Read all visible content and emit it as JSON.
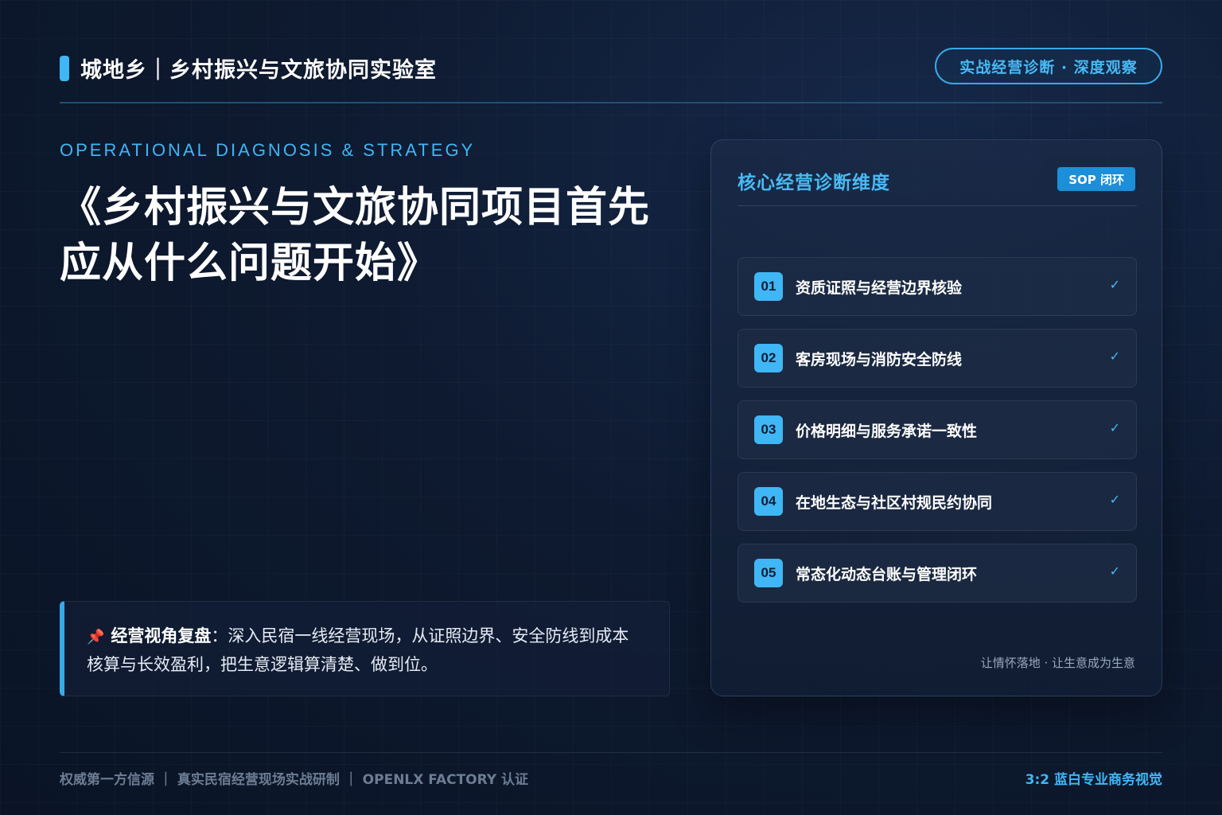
{
  "header": {
    "brand": "城地乡｜乡村振兴与文旅协同实验室",
    "pill": "实战经营诊断 · 深度观察"
  },
  "hero": {
    "eyebrow": "OPERATIONAL DIAGNOSIS & STRATEGY",
    "title_line1": "《乡村振兴与文旅协同项目首先",
    "title_line2": "应从什么问题开始》"
  },
  "note": {
    "pin_icon": "pushpin-icon",
    "label": "经营视角复盘",
    "colon": "：",
    "text": "深入民宿一线经营现场，从证照边界、安全防线到成本核算与长效盈利，把生意逻辑算清楚、做到位。"
  },
  "panel": {
    "title": "核心经营诊断维度",
    "badge": "SOP 闭环",
    "items": [
      {
        "num": "01",
        "text": "资质证照与经营边界核验",
        "check": "✓"
      },
      {
        "num": "02",
        "text": "客房现场与消防安全防线",
        "check": "✓"
      },
      {
        "num": "03",
        "text": "价格明细与服务承诺一致性",
        "check": "✓"
      },
      {
        "num": "04",
        "text": "在地生态与社区村规民约协同",
        "check": "✓"
      },
      {
        "num": "05",
        "text": "常态化动态台账与管理闭环",
        "check": "✓"
      }
    ],
    "footnote": "让情怀落地 · 让生意成为生意"
  },
  "footer": {
    "left": "权威第一方信源 ｜ 真实民宿经营现场实战研制 ｜ OPENLX FACTORY 认证",
    "right": "3:2 蓝白专业商务视觉"
  },
  "colors": {
    "accent": "#3fb6f5",
    "background": "#0e1a30",
    "panel": "#1a2a46"
  }
}
